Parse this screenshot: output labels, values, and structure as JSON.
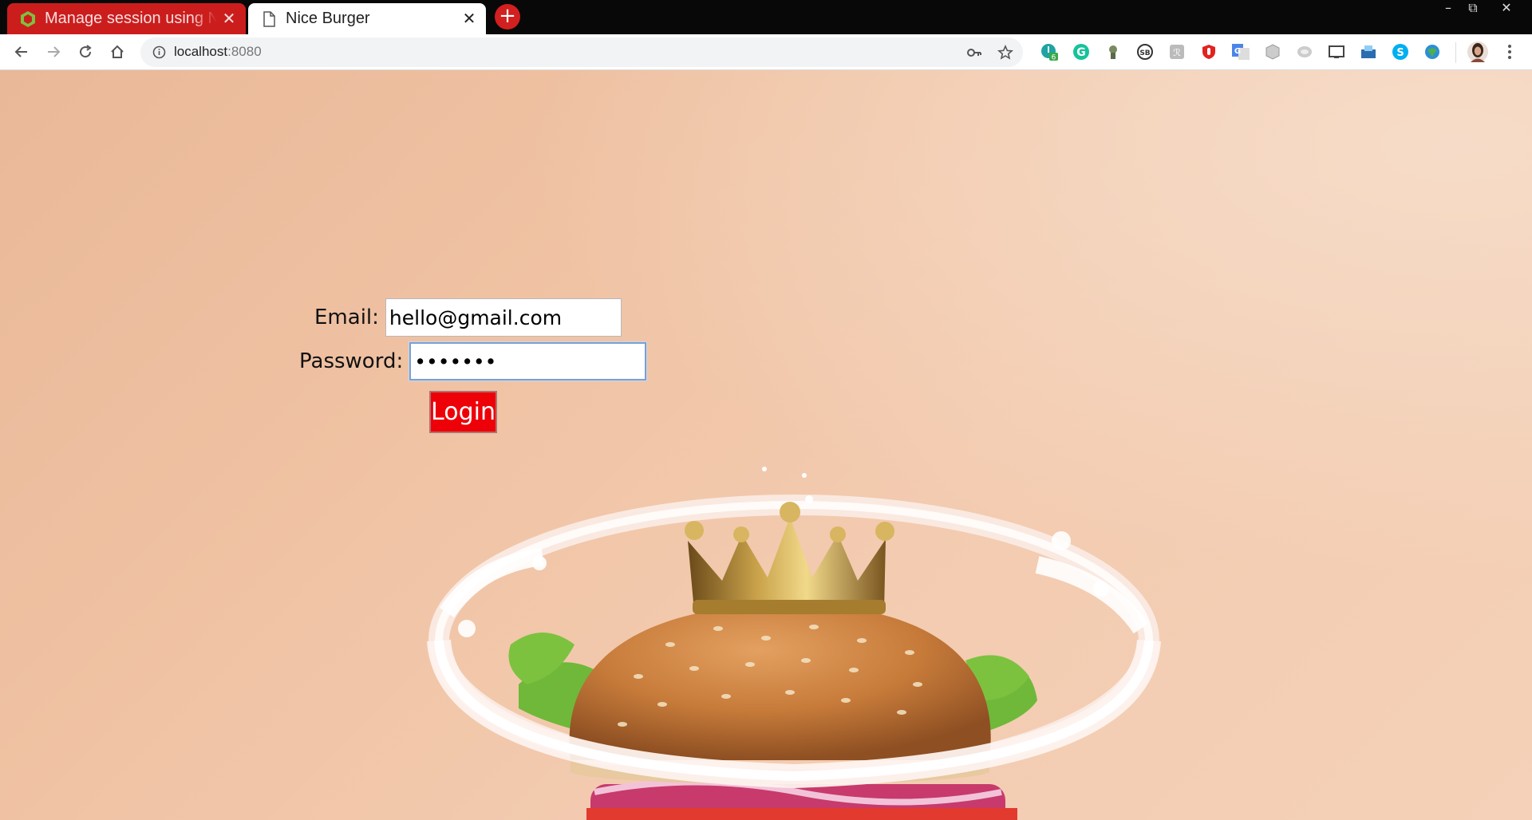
{
  "browser": {
    "tabs": [
      {
        "title": "Manage session using Node.js",
        "active": false,
        "close_label": "✕",
        "favicon": "node-icon"
      },
      {
        "title": "Nice Burger",
        "active": true,
        "close_label": "✕",
        "favicon": "page-icon"
      }
    ],
    "new_tab_label": "+",
    "window_controls": {
      "minimize": "–",
      "restore": "⧉",
      "close": "✕"
    },
    "address": {
      "host": "localhost",
      "port": ":8080"
    },
    "extensions": [
      "extension-badge-icon",
      "grammarly-icon",
      "extension-icon",
      "sb-icon",
      "extension-icon",
      "extension-icon",
      "translate-icon",
      "extension-icon",
      "extension-icon",
      "cast-icon",
      "extension-icon",
      "skype-icon",
      "extension-icon"
    ],
    "extension_badge_count": "6"
  },
  "login_form": {
    "email_label": "Email:",
    "email_value": "hello@gmail.com",
    "password_label": "Password:",
    "password_value": "•••••••",
    "login_label": "Login"
  },
  "colors": {
    "accent_red": "#ee0008",
    "tab_red": "#cc1d1d",
    "page_background": "#f0c3a4"
  }
}
